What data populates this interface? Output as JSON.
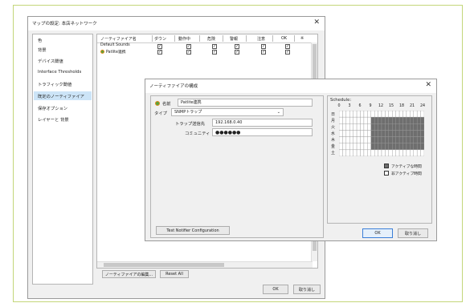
{
  "main_window": {
    "title": "マップの設定: 本店ネットワーク",
    "close_glyph": "✕",
    "sidebar": [
      "色",
      "背景",
      "デバイス閾値",
      "Interface Thresholds",
      "トラフィック閾値",
      "既定のノーティファイア",
      "保存オプション",
      "レイヤーと 背景"
    ],
    "selected_sidebar_index": 5,
    "columns": [
      "ノーティファイア名",
      "ダウン",
      "動作中",
      "危険",
      "警報",
      "注意",
      "OK",
      "※"
    ],
    "rows": [
      {
        "name": "Default Sounds",
        "checks": [
          true,
          true,
          true,
          true,
          true,
          true
        ]
      },
      {
        "name": "Patlite連携",
        "checks": [
          true,
          true,
          true,
          true,
          true,
          true
        ]
      }
    ],
    "edit_button": "ノーティファイアの編集...",
    "reset_button": "Reset All",
    "ok_button": "OK",
    "cancel_button": "取り消し"
  },
  "dialog": {
    "title": "ノーティファイアの構成",
    "close_glyph": "✕",
    "name_label": "名前",
    "name_value": "Patlite連携",
    "type_label": "タイプ",
    "type_value": "SNMPトラップ",
    "dest_label": "トラップ送信先",
    "dest_value": "192.168.0.40",
    "community_label": "コミュニティ",
    "community_value": "●●●●●●",
    "test_button": "Test Notifier Configuration",
    "ok_button": "OK",
    "cancel_button": "取り消し",
    "schedule": {
      "label": "Schedule:",
      "hours": [
        "0",
        "3",
        "6",
        "9",
        "12",
        "15",
        "18",
        "21",
        "24"
      ],
      "days": [
        "日",
        "月",
        "火",
        "水",
        "木",
        "金",
        "土"
      ],
      "active_days": [
        1,
        2,
        3,
        4,
        5
      ],
      "active_hours": [
        9,
        24
      ],
      "active_color": "#6e6e6e",
      "legend_active": "アクティブな時間",
      "legend_inactive": "非アクティブ時間"
    }
  }
}
